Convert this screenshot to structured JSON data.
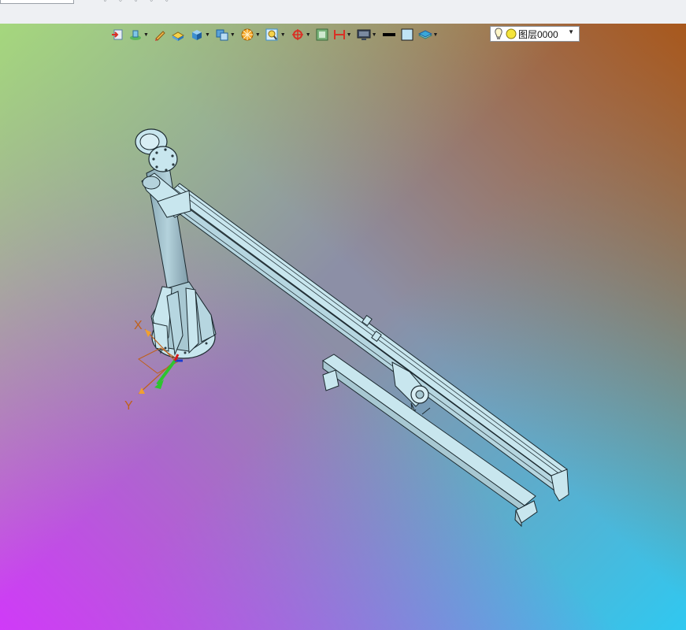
{
  "toolbar": {
    "items": [
      {
        "icon": "exit-sketch-icon"
      },
      {
        "icon": "feature-dropdown-icon"
      },
      {
        "icon": "pencil-icon"
      },
      {
        "icon": "solid-box-icon"
      },
      {
        "icon": "view-cube-icon"
      },
      {
        "icon": "view-orientation-icon"
      },
      {
        "icon": "section-wheel-icon"
      },
      {
        "icon": "zoom-fit-icon"
      },
      {
        "icon": "rotate-icon"
      },
      {
        "icon": "frame-icon"
      },
      {
        "icon": "dimension-icon"
      },
      {
        "icon": "display-mode-icon"
      },
      {
        "icon": "line-thickness-icon"
      },
      {
        "icon": "fill-color-icon"
      },
      {
        "icon": "layer-plane-icon"
      }
    ],
    "layer": {
      "label": "图层0000",
      "bulb_icon": "lightbulb-icon",
      "lamp_icon": "layer-lamp-icon"
    }
  },
  "viewport": {
    "axes": {
      "x_label": "X",
      "y_label": "Y"
    },
    "colors": {
      "top_left": "#a5d77d",
      "top_right": "#a8581c",
      "bottom_left": "#d03af8",
      "bottom_right": "#30c8f0",
      "model": "#c8e6ee",
      "axis_label": "#c0601a"
    }
  }
}
